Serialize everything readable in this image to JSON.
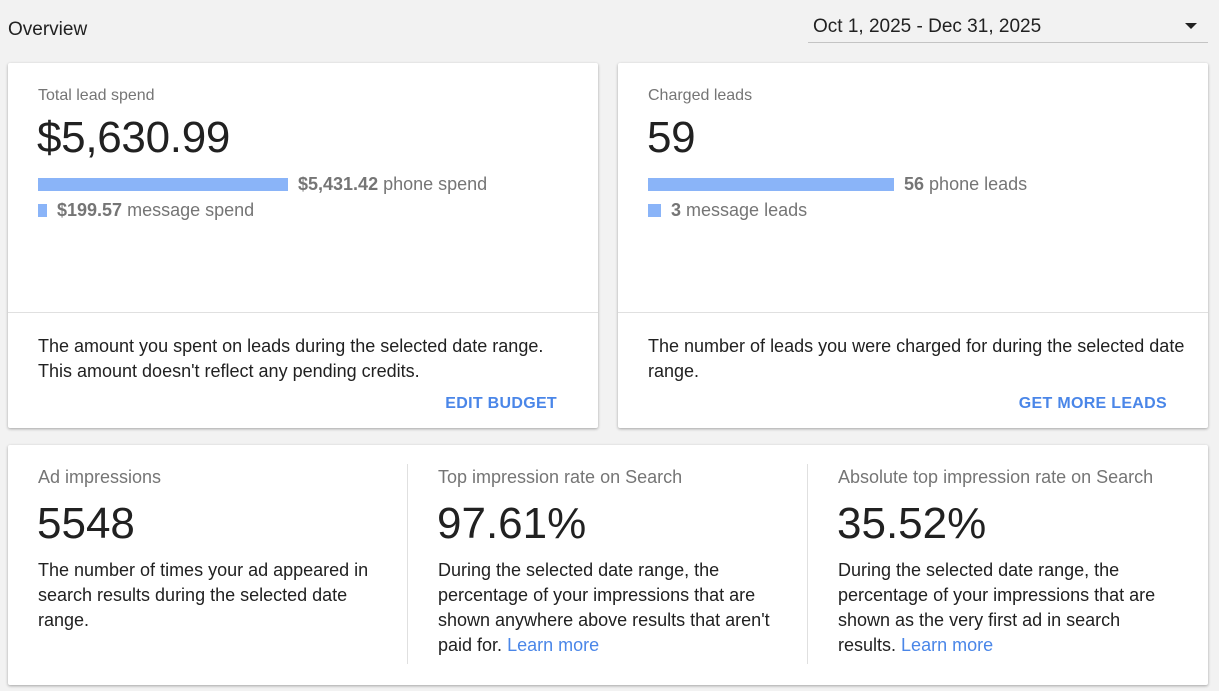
{
  "header": {
    "title": "Overview",
    "date_range": "Oct 1, 2025 - Dec 31, 2025",
    "dropdown_icon": "triangle-down-icon"
  },
  "spend_card": {
    "label": "Total lead spend",
    "value": "$5,630.99",
    "phone": {
      "amount": "$5,431.42",
      "label": "phone spend",
      "fraction": 0.9646
    },
    "message": {
      "amount": "$199.57",
      "label": "message spend",
      "fraction": 0.0354
    },
    "description": "The amount you spent on leads during the selected date range. This amount doesn't reflect any pending credits.",
    "action": "EDIT BUDGET"
  },
  "leads_card": {
    "label": "Charged leads",
    "value": "59",
    "phone": {
      "amount": "56",
      "label": "phone leads",
      "fraction": 0.949
    },
    "message": {
      "amount": "3",
      "label": "message leads",
      "fraction": 0.051
    },
    "description": "The number of leads you were charged for during the selected date range.",
    "action": "GET MORE LEADS"
  },
  "impressions_card": {
    "metrics": [
      {
        "label": "Ad impressions",
        "value": "5548",
        "description": "The number of times your ad appeared in search results during the selected date range.",
        "link": ""
      },
      {
        "label": "Top impression rate on Search",
        "value": "97.61%",
        "description": "During the selected date range, the percentage of your impressions that are shown anywhere above results that aren't paid for.",
        "link": "Learn more"
      },
      {
        "label": "Absolute top impression rate on Search",
        "value": "35.52%",
        "description": "During the selected date range, the percentage of your impressions that are shown as the very first ad in search results.",
        "link": "Learn more"
      }
    ]
  },
  "colors": {
    "bar": "#8ab4f8",
    "link": "#4a86e8",
    "background": "#f2f2f2"
  }
}
